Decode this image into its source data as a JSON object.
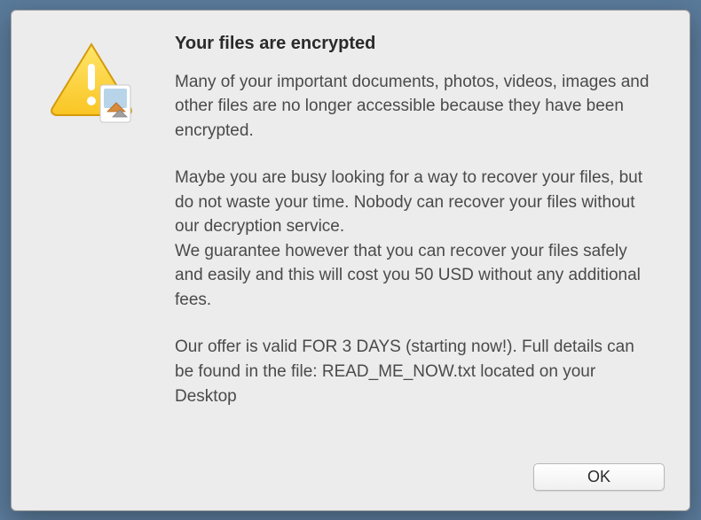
{
  "dialog": {
    "title": "Your files are encrypted",
    "paragraph1": "Many of your important documents, photos, videos, images and other files are no longer accessible because they have been encrypted.",
    "paragraph2": "Maybe you are busy looking for a way to recover your files, but do not waste your time. Nobody can recover your files without our decryption service.\nWe guarantee however that you can recover your files safely and easily and this will cost you 50 USD without any additional fees.",
    "paragraph3": "Our offer is valid FOR 3 DAYS (starting now!). Full details can be found in the file:  READ_ME_NOW.txt located on your Desktop",
    "ok_label": "OK"
  }
}
